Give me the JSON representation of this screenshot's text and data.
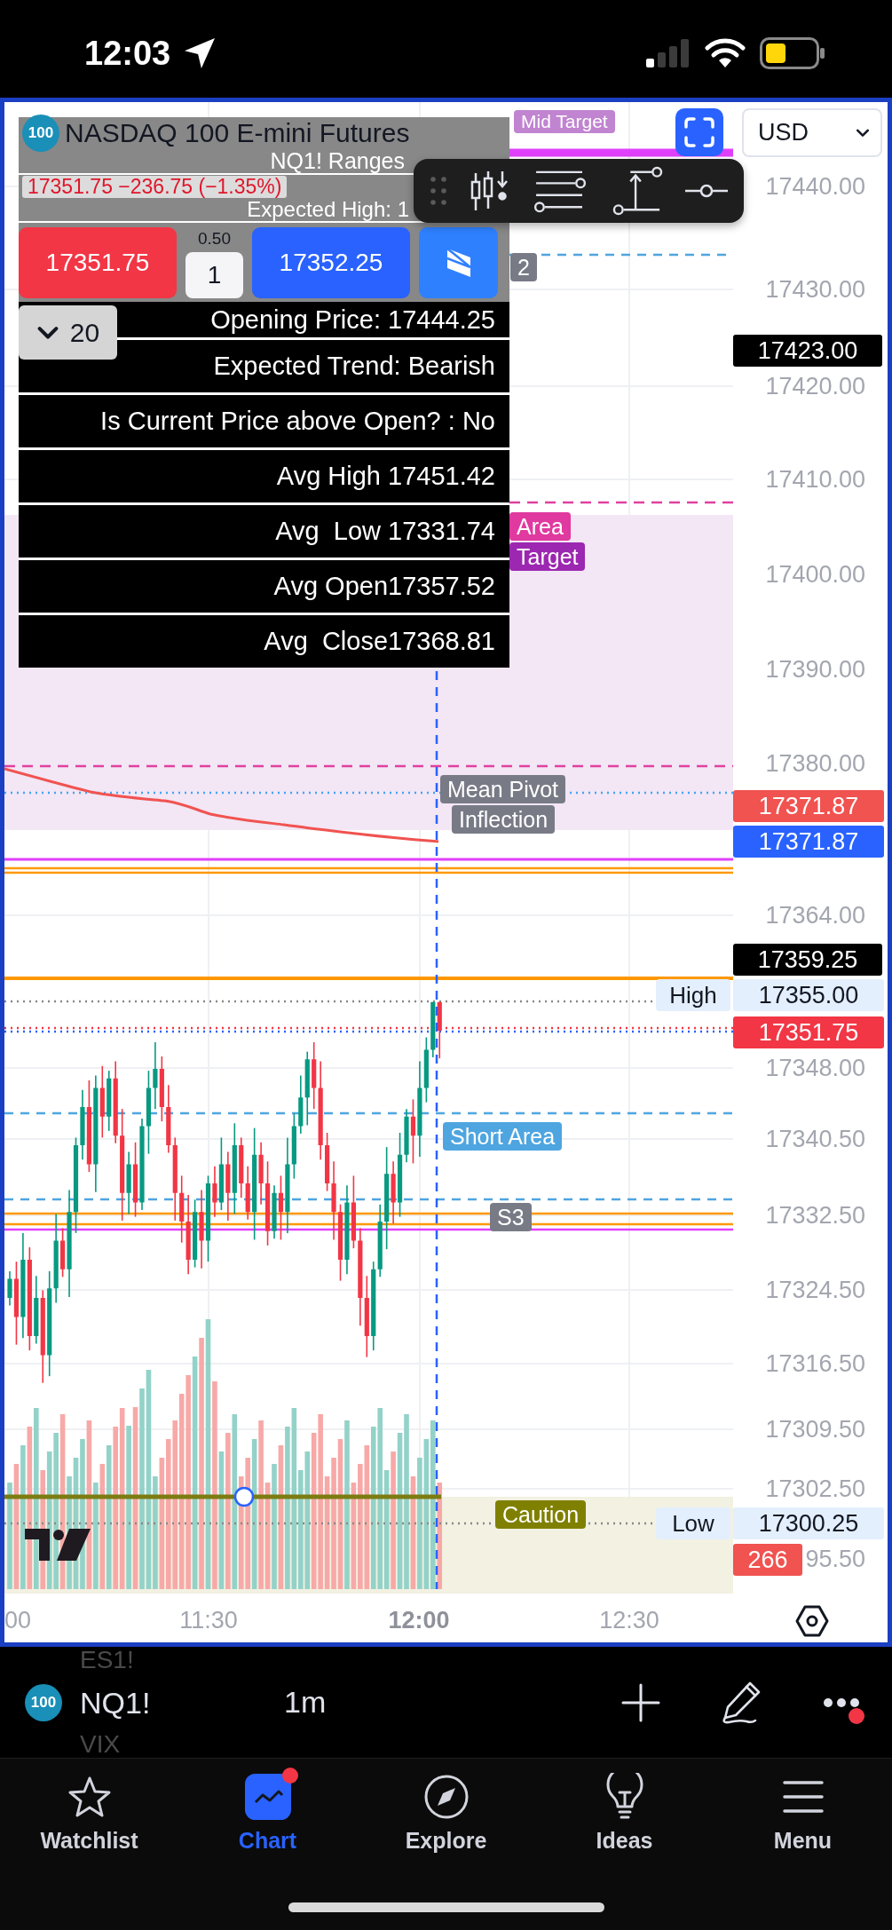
{
  "status_bar": {
    "time": "12:03"
  },
  "chart": {
    "symbol": {
      "logo": "100",
      "name": "NASDAQ 100 E-mini Futures",
      "quote": "17351.75 −236.75 (−1.35%)"
    },
    "ranges_table": {
      "title": "NQ1! Ranges",
      "partial_row": "Expected High: 1",
      "rows": [
        "Opening Price: 17444.25",
        "Expected Trend: Bearish",
        "Is Current Price above Open? : No",
        "Avg High 17451.42",
        "Avg  Low 17331.74",
        "Avg Open17357.52",
        "Avg  Close17368.81"
      ]
    },
    "order_panel": {
      "sell_price": "17351.75",
      "spread": "0.50",
      "quantity": "1",
      "buy_price": "17352.25"
    },
    "collapse_button": {
      "count": "20"
    },
    "currency": "USD",
    "price_axis": [
      "17440.00",
      "17430.00",
      "17420.00",
      "17410.00",
      "17400.00",
      "17390.00",
      "17380.00",
      "17364.00",
      "17348.00",
      "17340.50",
      "17332.50",
      "17324.50",
      "17316.50",
      "17309.50",
      "17302.50",
      "95.50"
    ],
    "price_tags": [
      {
        "value": "17423.00",
        "color": "#000000"
      },
      {
        "value": "17371.87",
        "color": "#f05350"
      },
      {
        "value": "17371.87",
        "color": "#2962ff"
      },
      {
        "value": "17359.25",
        "color": "#000000"
      },
      {
        "caption": "High",
        "value": "17355.00",
        "color": "#e3effd"
      },
      {
        "value": "17351.75",
        "color": "#f23645"
      },
      {
        "caption": "Low",
        "value": "17300.25",
        "color": "#e3effd"
      },
      {
        "value": "266",
        "color": "#f05350"
      }
    ],
    "level_labels": [
      {
        "text": "Mid Target",
        "color": "#c084d0"
      },
      {
        "text": "2",
        "color": "#787b86"
      },
      {
        "text": "Area",
        "color": "#e0399f"
      },
      {
        "text": "Target",
        "color": "#9c27b0"
      },
      {
        "text": "Mean Pivot",
        "color": "#787b86"
      },
      {
        "text": "Inflection",
        "color": "#787b86"
      },
      {
        "text": "Short Area",
        "color": "#4ea5e0"
      },
      {
        "text": "S3",
        "color": "#787b86"
      },
      {
        "text": "Caution",
        "color": "#808000"
      }
    ],
    "time_axis": [
      {
        "label": "00",
        "current": false
      },
      {
        "label": "11:30",
        "current": false
      },
      {
        "label": "12:00",
        "current": true
      },
      {
        "label": "12:30",
        "current": false
      }
    ]
  },
  "symbol_bar": {
    "logo": "100",
    "previous_symbol": "ES1!",
    "symbol": "NQ1!",
    "next_symbol": "VIX",
    "interval": "1m",
    "more_notification": true
  },
  "tab_bar": [
    {
      "label": "Watchlist",
      "selected": false,
      "notification": false
    },
    {
      "label": "Chart",
      "selected": true,
      "notification": true
    },
    {
      "label": "Explore",
      "selected": false,
      "notification": false
    },
    {
      "label": "Ideas",
      "selected": false,
      "notification": false
    },
    {
      "label": "Menu",
      "selected": false,
      "notification": false
    }
  ]
}
